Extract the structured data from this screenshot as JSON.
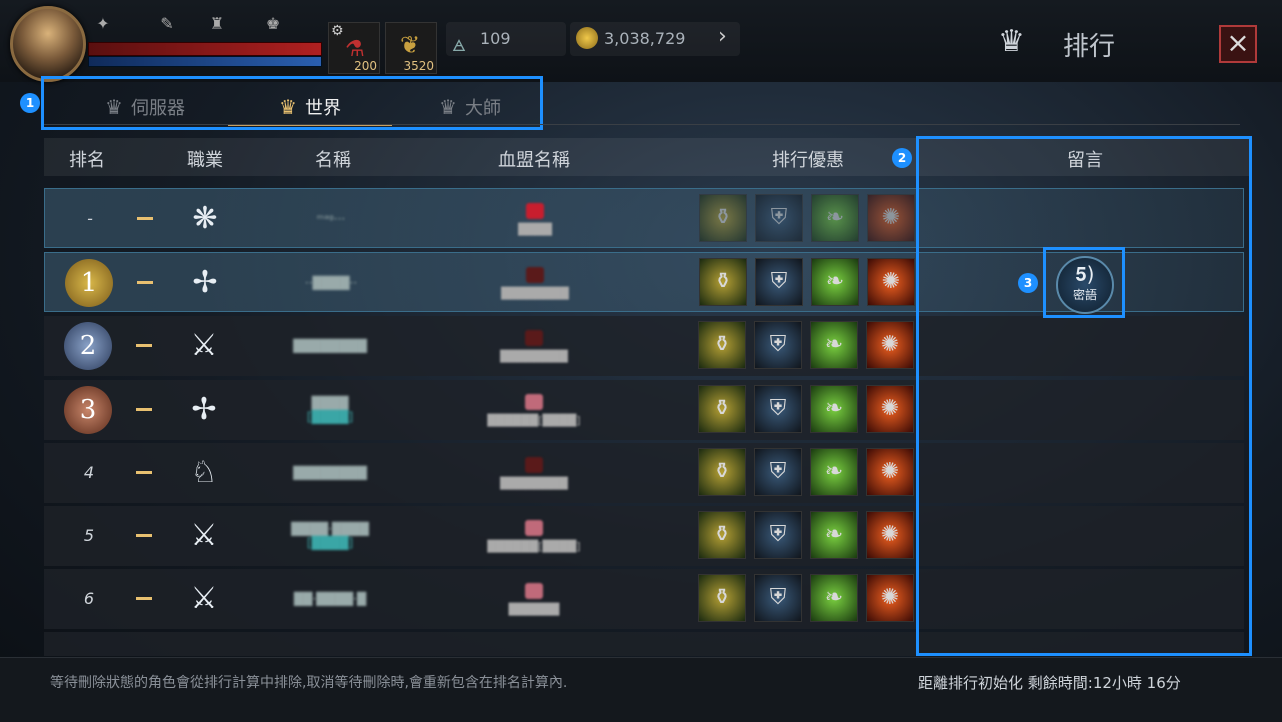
{
  "topbar": {
    "icons": [
      "boost-icon",
      "quill-icon",
      "armor-icon",
      "trophy-icon"
    ],
    "potion_count": "200",
    "leaf_count": "3520",
    "wing_currency": "109",
    "gold_currency": "3,038,729"
  },
  "title": "排行",
  "tabs": [
    {
      "label": "伺服器",
      "icon": "server-trophy-icon",
      "active": false
    },
    {
      "label": "世界",
      "icon": "world-trophy-icon",
      "active": true
    },
    {
      "label": "大師",
      "icon": "master-trophy-icon",
      "active": false
    }
  ],
  "columns": {
    "rank": "排名",
    "job": "職業",
    "name": "名稱",
    "guild": "血盟名稱",
    "rewards": "排行優惠",
    "message": "留言"
  },
  "rows": [
    {
      "rank": "-",
      "medal": "",
      "job": "mage-icon",
      "name": "ᵐᵃᵍ···",
      "guild": "████"
    },
    {
      "rank": "1",
      "medal": "gold",
      "job": "archer-icon",
      "name": "··████··",
      "guild": "████████"
    },
    {
      "rank": "2",
      "medal": "silver",
      "job": "sword-icon",
      "name": "████████",
      "guild": "████████"
    },
    {
      "rank": "3",
      "medal": "bronze",
      "job": "archer-icon",
      "name": "████",
      "name2": "[████]",
      "guild": "██████[████]"
    },
    {
      "rank": "4",
      "medal": "",
      "job": "wolf-icon",
      "name": "████████",
      "guild": "████████"
    },
    {
      "rank": "5",
      "medal": "",
      "job": "sword-icon",
      "name": "████·████",
      "name2": "[████]",
      "guild": "██████[████]"
    },
    {
      "rank": "6",
      "medal": "",
      "job": "sword-icon",
      "name": "██·████·█",
      "guild": "██████"
    }
  ],
  "whisper_label": "密語",
  "footer_note": "等待刪除狀態的角色會從排行計算中排除,取消等待刪除時,會重新包含在排名計算內.",
  "timer": "距離排行初始化 剩餘時間:12小時 16分",
  "callouts": [
    "1",
    "2",
    "3"
  ],
  "accent": "#1e90ff"
}
